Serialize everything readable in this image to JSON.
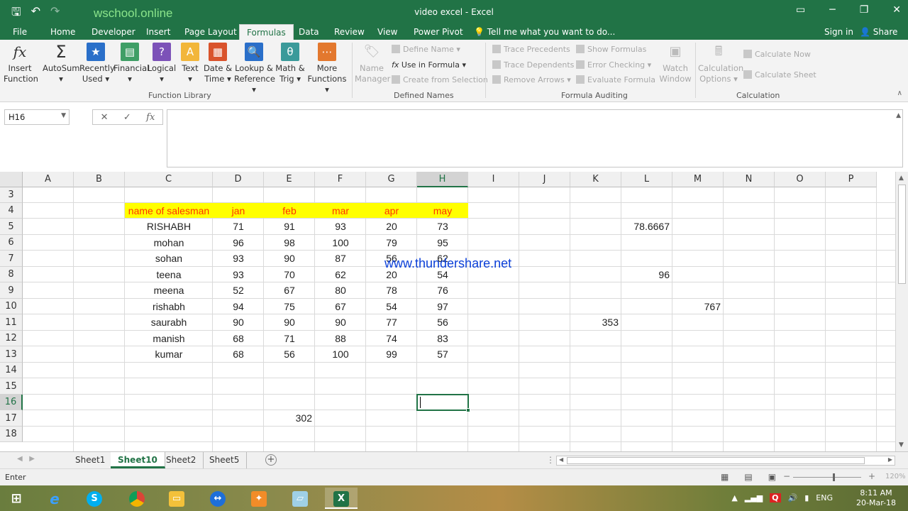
{
  "window": {
    "title": "video excel - Excel",
    "watermark": "wschool.online",
    "overlay_watermark": "www.thundershare.net"
  },
  "tabs": [
    "File",
    "Home",
    "Developer",
    "Insert",
    "Page Layout",
    "Formulas",
    "Data",
    "Review",
    "View",
    "Power Pivot"
  ],
  "active_tab": "Formulas",
  "tell_me": "Tell me what you want to do...",
  "sign_in": "Sign in",
  "share": "Share",
  "ribbon": {
    "function_library": {
      "label": "Function Library",
      "insert_function": [
        "Insert",
        "Function"
      ],
      "autosum": [
        "AutoSum",
        ""
      ],
      "recently_used": [
        "Recently",
        "Used"
      ],
      "financial": [
        "Financial",
        ""
      ],
      "logical": [
        "Logical",
        ""
      ],
      "text": [
        "Text",
        ""
      ],
      "date_time": [
        "Date &",
        "Time"
      ],
      "lookup": [
        "Lookup &",
        "Reference"
      ],
      "math": [
        "Math &",
        "Trig"
      ],
      "more": [
        "More",
        "Functions"
      ]
    },
    "defined_names": {
      "label": "Defined Names",
      "name_manager": [
        "Name",
        "Manager"
      ],
      "define_name": "Define Name",
      "use_in_formula": "Use in Formula",
      "create_from_selection": "Create from Selection"
    },
    "formula_auditing": {
      "label": "Formula Auditing",
      "trace_precedents": "Trace Precedents",
      "trace_dependents": "Trace Dependents",
      "remove_arrows": "Remove Arrows",
      "show_formulas": "Show Formulas",
      "error_checking": "Error Checking",
      "evaluate_formula": "Evaluate Formula",
      "watch_window": [
        "Watch",
        "Window"
      ]
    },
    "calculation": {
      "label": "Calculation",
      "calc_options": [
        "Calculation",
        "Options"
      ],
      "calculate_now": "Calculate Now",
      "calculate_sheet": "Calculate Sheet"
    }
  },
  "formula_bar": {
    "name_box": "H16",
    "cancel": "✕",
    "enter": "✓",
    "fx": "fx",
    "value": ""
  },
  "grid": {
    "columns": [
      "A",
      "B",
      "C",
      "D",
      "E",
      "F",
      "G",
      "H",
      "I",
      "J",
      "K",
      "L",
      "M",
      "N",
      "O",
      "P"
    ],
    "selected_column": "H",
    "rows": [
      "3",
      "4",
      "5",
      "6",
      "7",
      "8",
      "9",
      "10",
      "11",
      "12",
      "13",
      "14",
      "15",
      "16",
      "17",
      "18"
    ],
    "selected_row": "16",
    "selected_cell": "H16",
    "header_row": [
      "name of salesman",
      "jan",
      "feb",
      "mar",
      "apr",
      "may"
    ],
    "data_rows": [
      [
        "RISHABH",
        "71",
        "91",
        "93",
        "20",
        "73"
      ],
      [
        "mohan",
        "96",
        "98",
        "100",
        "79",
        "95"
      ],
      [
        "sohan",
        "93",
        "90",
        "87",
        "56",
        "62"
      ],
      [
        "teena",
        "93",
        "70",
        "62",
        "20",
        "54"
      ],
      [
        "meena",
        "52",
        "67",
        "80",
        "78",
        "76"
      ],
      [
        "rishabh",
        "94",
        "75",
        "67",
        "54",
        "97"
      ],
      [
        "saurabh",
        "90",
        "90",
        "90",
        "77",
        "56"
      ],
      [
        "manish",
        "68",
        "71",
        "88",
        "74",
        "83"
      ],
      [
        "kumar",
        "68",
        "56",
        "100",
        "99",
        "57"
      ]
    ],
    "extra_cells": {
      "L5": "78.6667",
      "L8": "96",
      "M10": "767",
      "K11": "353",
      "E17": "302"
    }
  },
  "sheets": [
    "Sheet1",
    "Sheet10",
    "Sheet2",
    "Sheet5"
  ],
  "active_sheet": "Sheet10",
  "status": {
    "mode": "Enter",
    "zoom": "120%"
  },
  "taskbar": {
    "lang": "ENG",
    "time": "8:11 AM",
    "date": "20-Mar-18"
  }
}
